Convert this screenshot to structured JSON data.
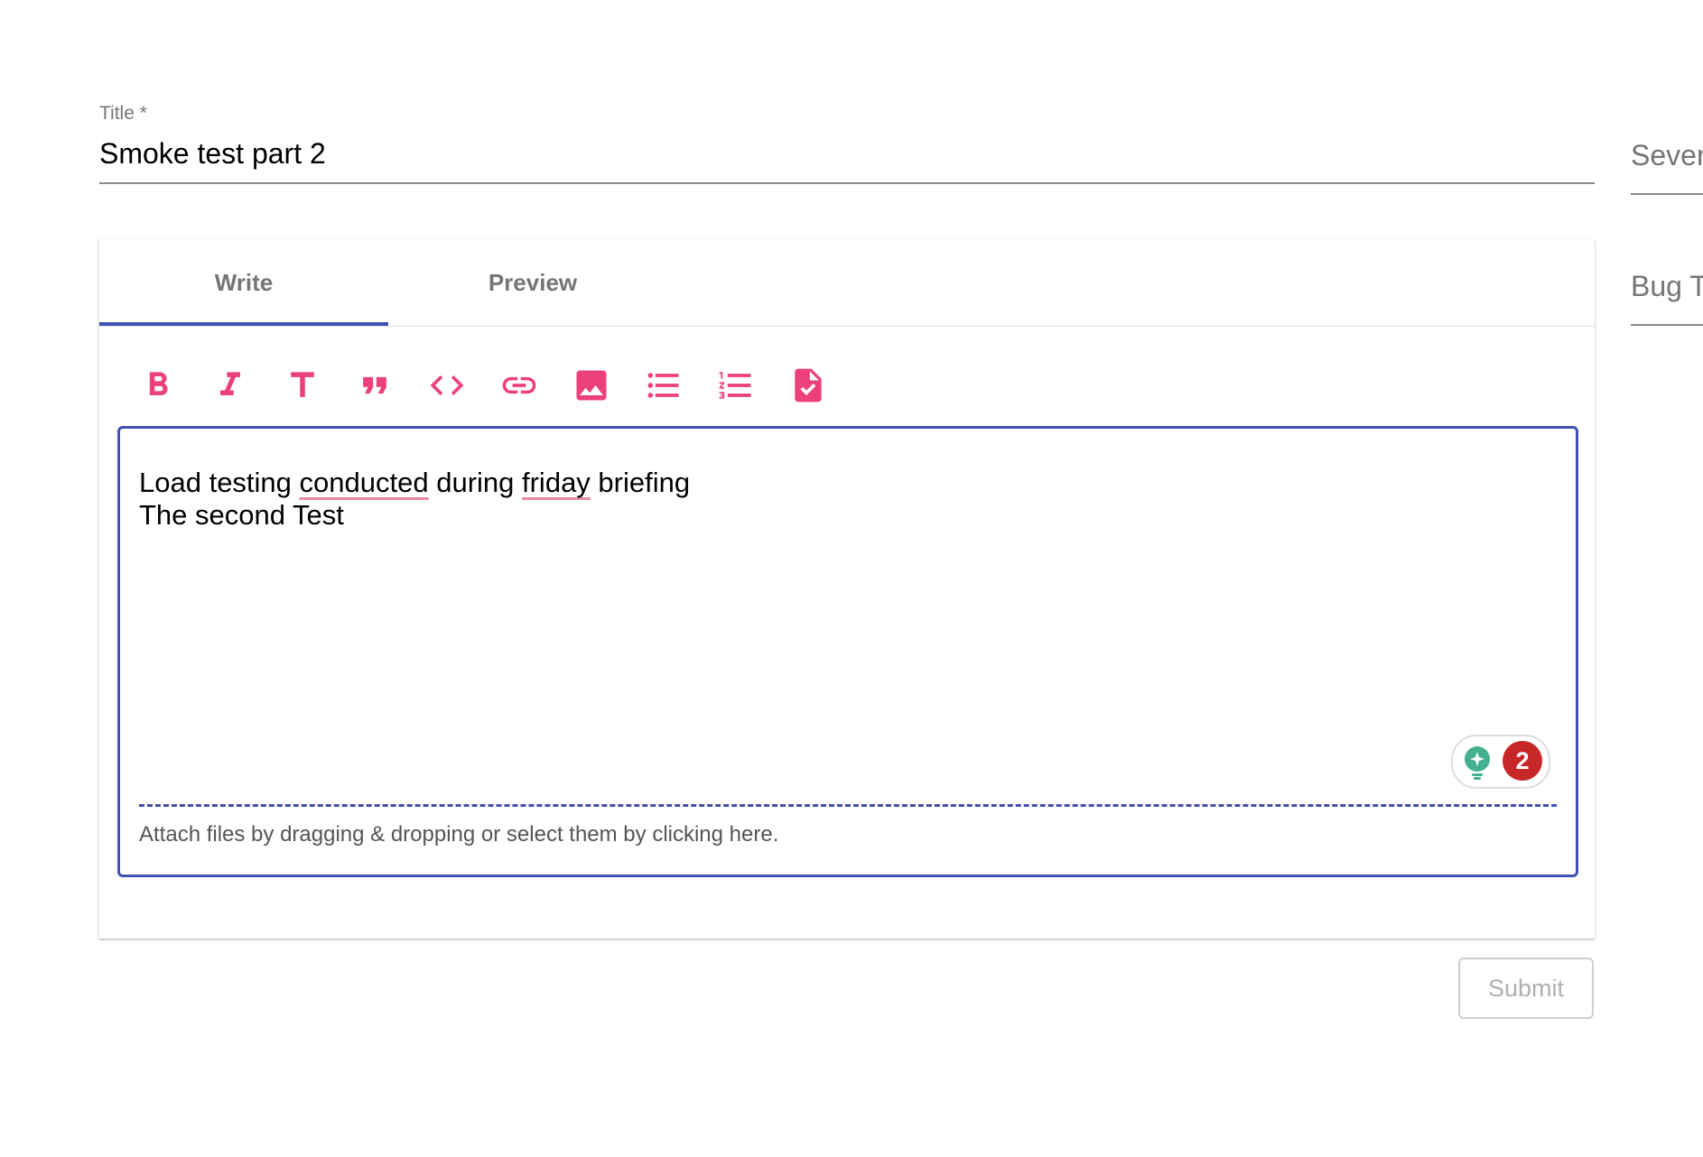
{
  "title_field": {
    "label": "Title *",
    "value": "Smoke test part 2"
  },
  "side_fields": [
    {
      "label": "Sever"
    },
    {
      "label": "Bug T"
    }
  ],
  "tabs": [
    {
      "label": "Write",
      "active": true
    },
    {
      "label": "Preview",
      "active": false
    }
  ],
  "toolbar": {
    "color": "#ec407a",
    "icons": [
      "bold-icon",
      "italic-icon",
      "header-icon",
      "quote-icon",
      "code-icon",
      "link-icon",
      "image-icon",
      "bulleted-list-icon",
      "numbered-list-icon",
      "task-list-icon"
    ]
  },
  "editor": {
    "line1": {
      "w1": "Load testing ",
      "w2": "conducted",
      "w3": " during ",
      "w4": "friday",
      "w5": " briefing"
    },
    "line2": "The second Test",
    "attach_text": "Attach files by dragging & dropping or select them by clicking here.",
    "accent_color": "#3f51b5"
  },
  "grammar_widget": {
    "count": "2",
    "badge_color": "#c62828"
  },
  "submit_label": "Submit"
}
